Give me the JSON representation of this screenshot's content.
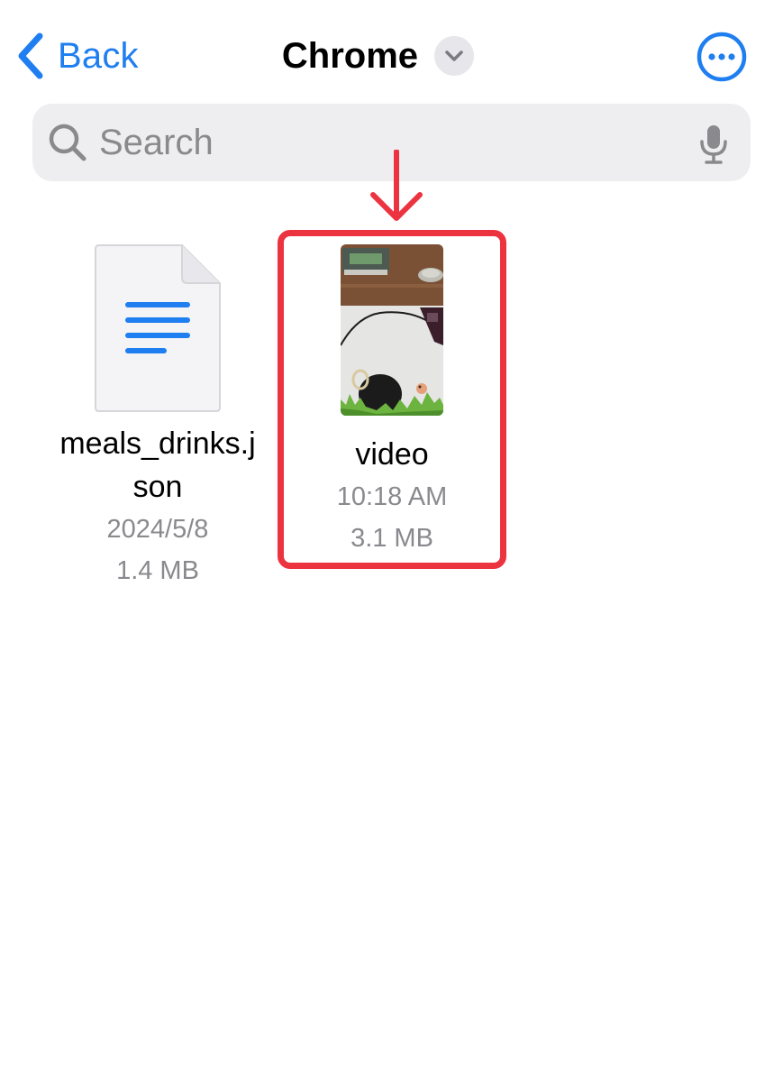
{
  "nav": {
    "back_label": "Back",
    "title": "Chrome",
    "accent_color": "#1f7ef0"
  },
  "search": {
    "placeholder": "Search",
    "value": ""
  },
  "annotation": {
    "color": "#ec3340"
  },
  "files": [
    {
      "name": "meals_drinks.json",
      "date": "2024/5/8",
      "size": "1.4 MB",
      "icon": "document-icon"
    },
    {
      "name": "video",
      "date": "10:18 AM",
      "size": "3.1 MB",
      "icon": "video-thumbnail"
    }
  ]
}
